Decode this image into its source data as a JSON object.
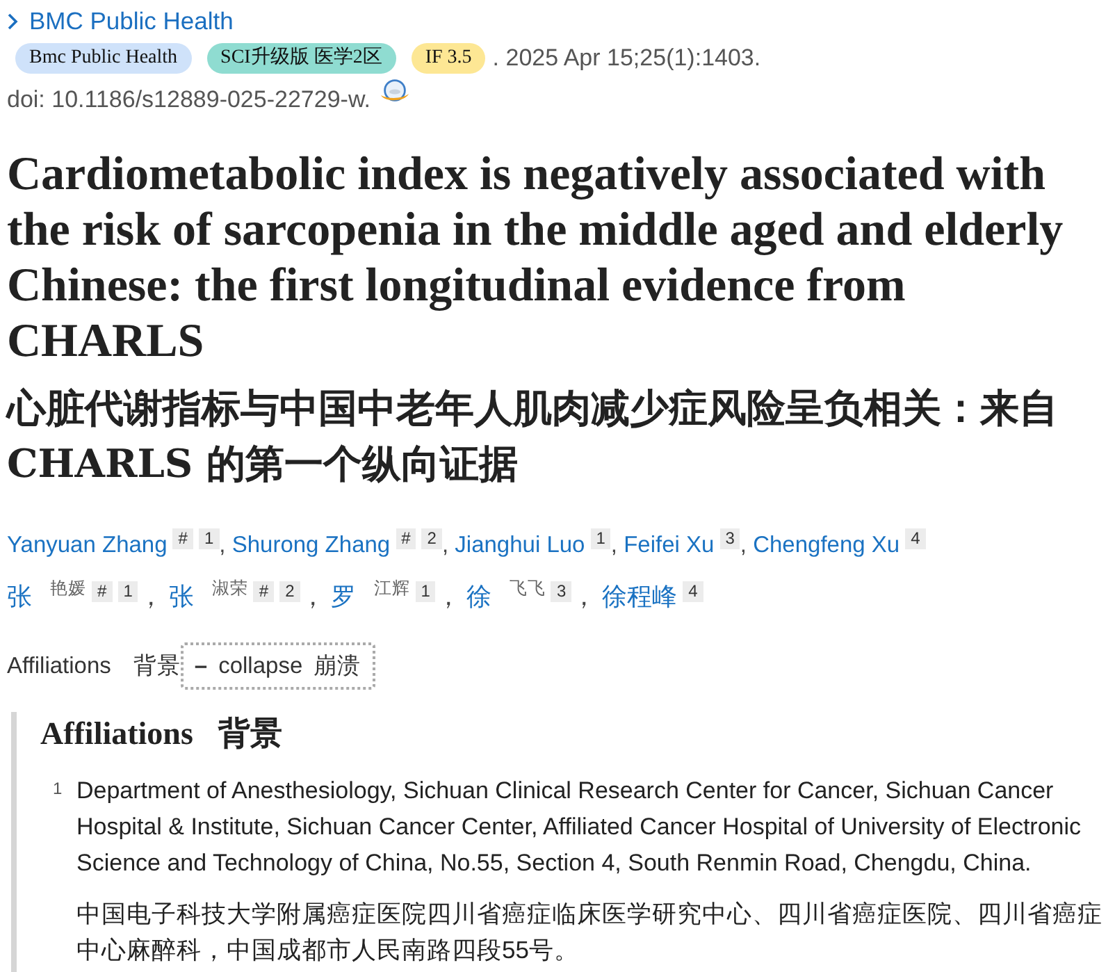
{
  "journal": {
    "name": "BMC Public Health"
  },
  "badges": [
    {
      "text": "Bmc Public Health",
      "color": "#cfe2fa"
    },
    {
      "text": "SCI升级版 医学2区",
      "color": "#8fdcd1"
    },
    {
      "text": "IF 3.5",
      "color": "#fde794"
    }
  ],
  "citation": ". 2025 Apr 15;25(1):1403.",
  "doi": "doi: 10.1186/s12889-025-22729-w.",
  "title": "Cardiometabolic index is negatively associated with the risk of sarcopenia in the middle aged and elderly Chinese: the first longitudinal evidence from CHARLS",
  "title_cn": "心脏代谢指标与中国中老年人肌肉减少症风险呈负相关：来自CHARLS 的第一个纵向证据",
  "authors": {
    "separator": ", ",
    "items": [
      {
        "name": "Yanyuan Zhang",
        "marks": [
          "#",
          "1"
        ]
      },
      {
        "name": "Shurong Zhang",
        "marks": [
          "#",
          "2"
        ]
      },
      {
        "name": "Jianghui Luo",
        "marks": [
          "1"
        ]
      },
      {
        "name": "Feifei Xu",
        "marks": [
          "3"
        ]
      },
      {
        "name": "Chengfeng Xu",
        "marks": [
          "4"
        ]
      }
    ]
  },
  "authors_cn": {
    "separator": "，",
    "items": [
      {
        "name": "张",
        "given": "艳媛",
        "marks": [
          "#",
          "1"
        ]
      },
      {
        "name": "张",
        "given": "淑荣",
        "marks": [
          "#",
          "2"
        ]
      },
      {
        "name": "罗",
        "given": "江辉",
        "marks": [
          "1"
        ]
      },
      {
        "name": "徐",
        "given": "飞飞",
        "marks": [
          "3"
        ]
      },
      {
        "name": "徐程峰",
        "marks": [
          "4"
        ]
      }
    ]
  },
  "affiliations_toggle": {
    "label": "Affiliations",
    "label_cn": "背景",
    "symbol": "–",
    "button": "collapse",
    "button_cn": "崩溃",
    "expanded": true
  },
  "affiliations": {
    "heading": "Affiliations",
    "heading_cn": "背景",
    "items": [
      {
        "number": "1",
        "text": "Department of Anesthesiology, Sichuan Clinical Research Center for Cancer, Sichuan Cancer Hospital & Institute, Sichuan Cancer Center, Affiliated Cancer Hospital of University of Electronic Science and Technology of China, No.55, Section 4, South Renmin Road, Chengdu, China.",
        "text_cn": "中国电子科技大学附属癌症医院四川省癌症临床医学研究中心、四川省癌症医院、四川省癌症中心麻醉科，中国成都市人民南路四段55号。"
      }
    ]
  }
}
